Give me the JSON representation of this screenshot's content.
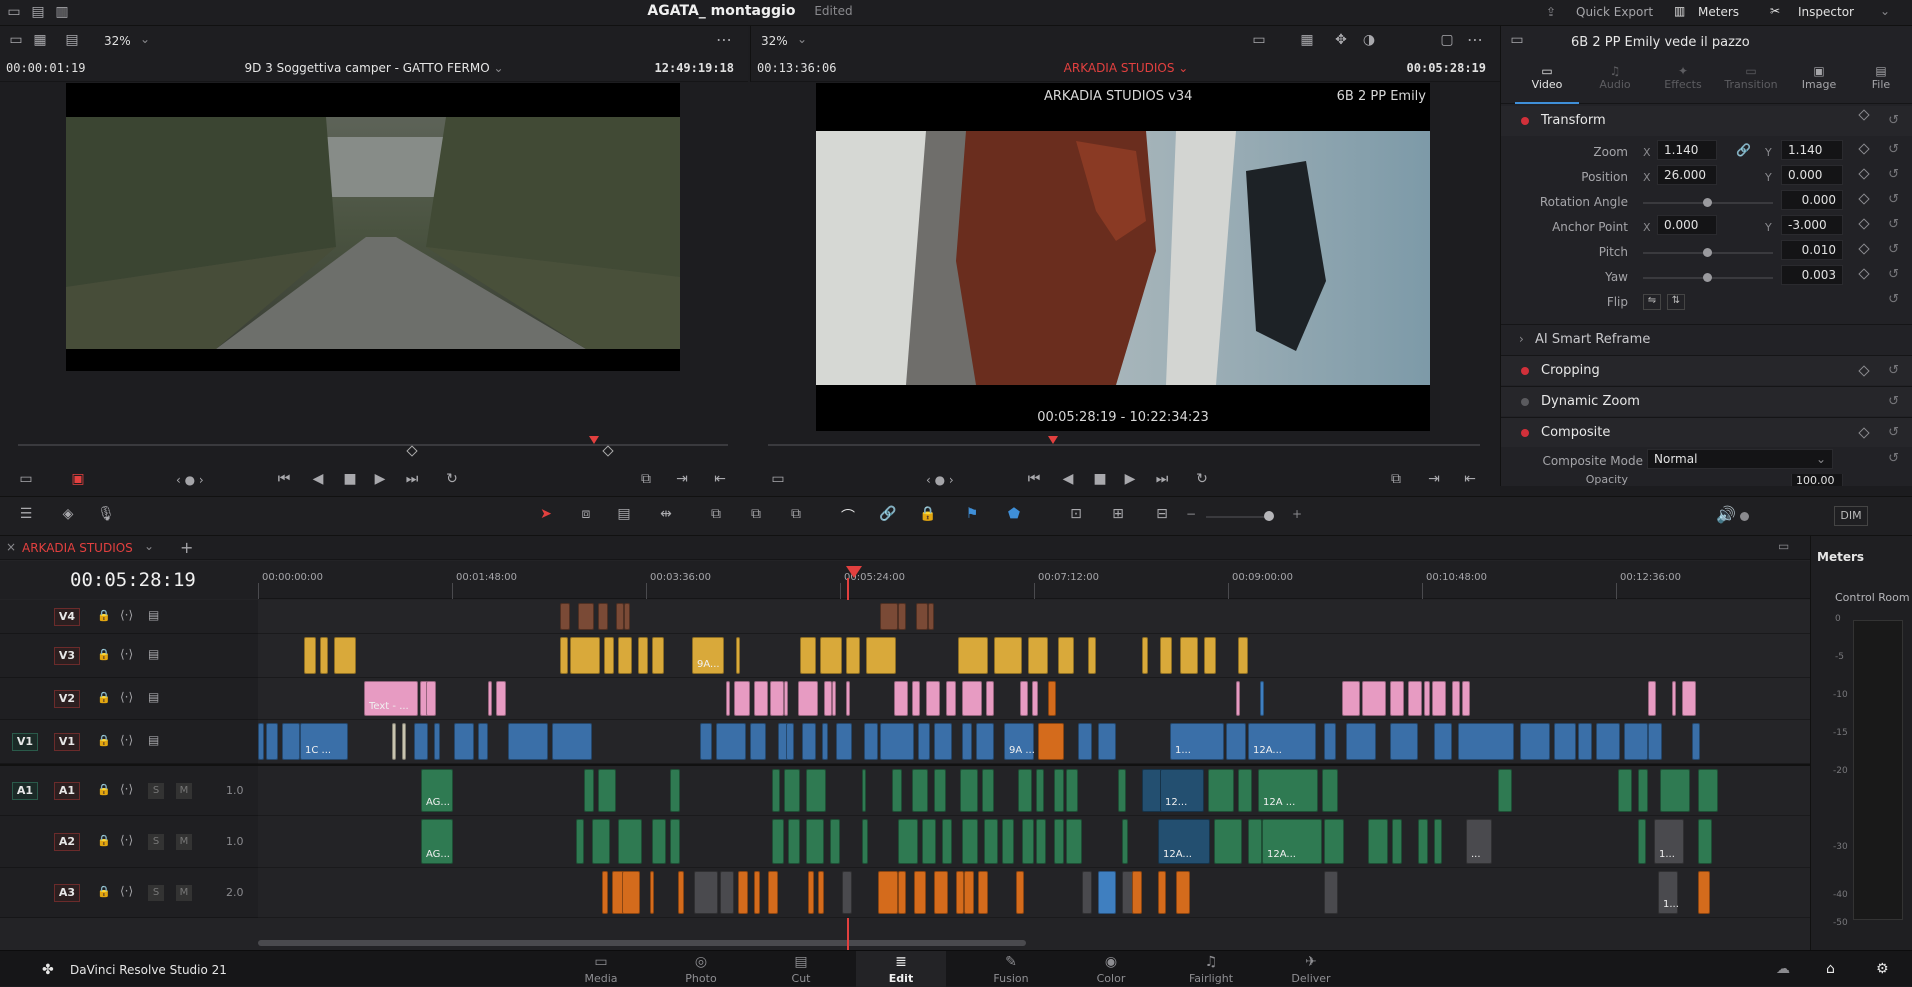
{
  "topbar": {
    "project": "AGATA_ montaggio",
    "status": "Edited",
    "quick_export": "Quick Export",
    "meters": "Meters",
    "inspector": "Inspector"
  },
  "source_viewer": {
    "zoom": "32%",
    "timecode_left": "00:00:01:19",
    "clip_name": "9D 3 Soggettiva camper - GATTO FERMO",
    "timecode_right": "12:49:19:18"
  },
  "timeline_viewer": {
    "zoom": "32%",
    "timecode_left": "00:13:36:06",
    "name": "ARKADIA STUDIOS",
    "timecode_right": "00:05:28:19",
    "overlay_left": "ARKADIA STUDIOS v34",
    "overlay_right": "6B 2 PP Emily",
    "overlay_bottom": "00:05:28:19 - 10:22:34:23"
  },
  "inspector": {
    "clip_title": "6B 2 PP Emily vede il pazzo",
    "tabs": [
      {
        "label": "Video",
        "active": true
      },
      {
        "label": "Audio",
        "active": false
      },
      {
        "label": "Effects",
        "active": false
      },
      {
        "label": "Transition",
        "active": false
      },
      {
        "label": "Image",
        "active": false
      },
      {
        "label": "File",
        "active": false
      }
    ],
    "transform": {
      "title": "Transform",
      "zoom_label": "Zoom",
      "zoom_x": "1.140",
      "zoom_y": "1.140",
      "position_label": "Position",
      "pos_x": "26.000",
      "pos_y": "0.000",
      "rotation_label": "Rotation Angle",
      "rotation": "0.000",
      "anchor_label": "Anchor Point",
      "anchor_x": "0.000",
      "anchor_y": "-3.000",
      "pitch_label": "Pitch",
      "pitch": "0.010",
      "yaw_label": "Yaw",
      "yaw": "0.003",
      "flip_label": "Flip",
      "x": "X",
      "y": "Y"
    },
    "sections": {
      "smart_reframe": "AI Smart Reframe",
      "cropping": "Cropping",
      "dynamic_zoom": "Dynamic Zoom",
      "composite": "Composite",
      "composite_mode_label": "Composite Mode",
      "composite_mode": "Normal",
      "opacity_label": "Opacity",
      "opacity": "100.00"
    }
  },
  "toolbar": {
    "dim": "DIM"
  },
  "timeline": {
    "tab_name": "ARKADIA STUDIOS",
    "current_tc": "00:05:28:19",
    "ruler": [
      "00:00:00:00",
      "00:01:48:00",
      "00:03:36:00",
      "00:05:24:00",
      "00:07:12:00",
      "00:09:00:00",
      "00:10:48:00",
      "00:12:36:00"
    ],
    "tracks": [
      {
        "id": "V4",
        "kind": "video"
      },
      {
        "id": "V3",
        "kind": "video"
      },
      {
        "id": "V2",
        "kind": "video"
      },
      {
        "id": "V1",
        "kind": "video",
        "src": "V1"
      },
      {
        "id": "A1",
        "kind": "audio",
        "src": "A1",
        "level": "1.0"
      },
      {
        "id": "A2",
        "kind": "audio",
        "level": "1.0"
      },
      {
        "id": "A3",
        "kind": "audio",
        "level": "2.0"
      }
    ],
    "labels": {
      "text_clip": "Text - ...",
      "v3_clip": "9A...",
      "v1_a": "1C ...",
      "v1_b": "9A ...",
      "v1_c": "1...",
      "v1_d": "12A...",
      "a1_a": "AG...",
      "a1_b": "12...",
      "a1_c": "12A ...",
      "a2_a": "AG...",
      "a2_b": "12A...",
      "a2_c": "12A...",
      "a2_d": "...",
      "a2_e": "1...",
      "a3_a": "1..."
    },
    "solo": "S",
    "mute": "M"
  },
  "meters": {
    "title": "Meters",
    "room": "Control Room",
    "scale": [
      "0",
      "-5",
      "-10",
      "-15",
      "-20",
      "-30",
      "-40",
      "-50"
    ]
  },
  "bottom": {
    "app": "DaVinci Resolve Studio 21",
    "pages": [
      {
        "label": "Media",
        "icon": "media-icon"
      },
      {
        "label": "Photo",
        "icon": "camera-icon"
      },
      {
        "label": "Cut",
        "icon": "cut-icon"
      },
      {
        "label": "Edit",
        "icon": "edit-icon",
        "active": true
      },
      {
        "label": "Fusion",
        "icon": "fusion-icon"
      },
      {
        "label": "Color",
        "icon": "color-icon"
      },
      {
        "label": "Fairlight",
        "icon": "music-icon"
      },
      {
        "label": "Deliver",
        "icon": "rocket-icon"
      }
    ]
  }
}
